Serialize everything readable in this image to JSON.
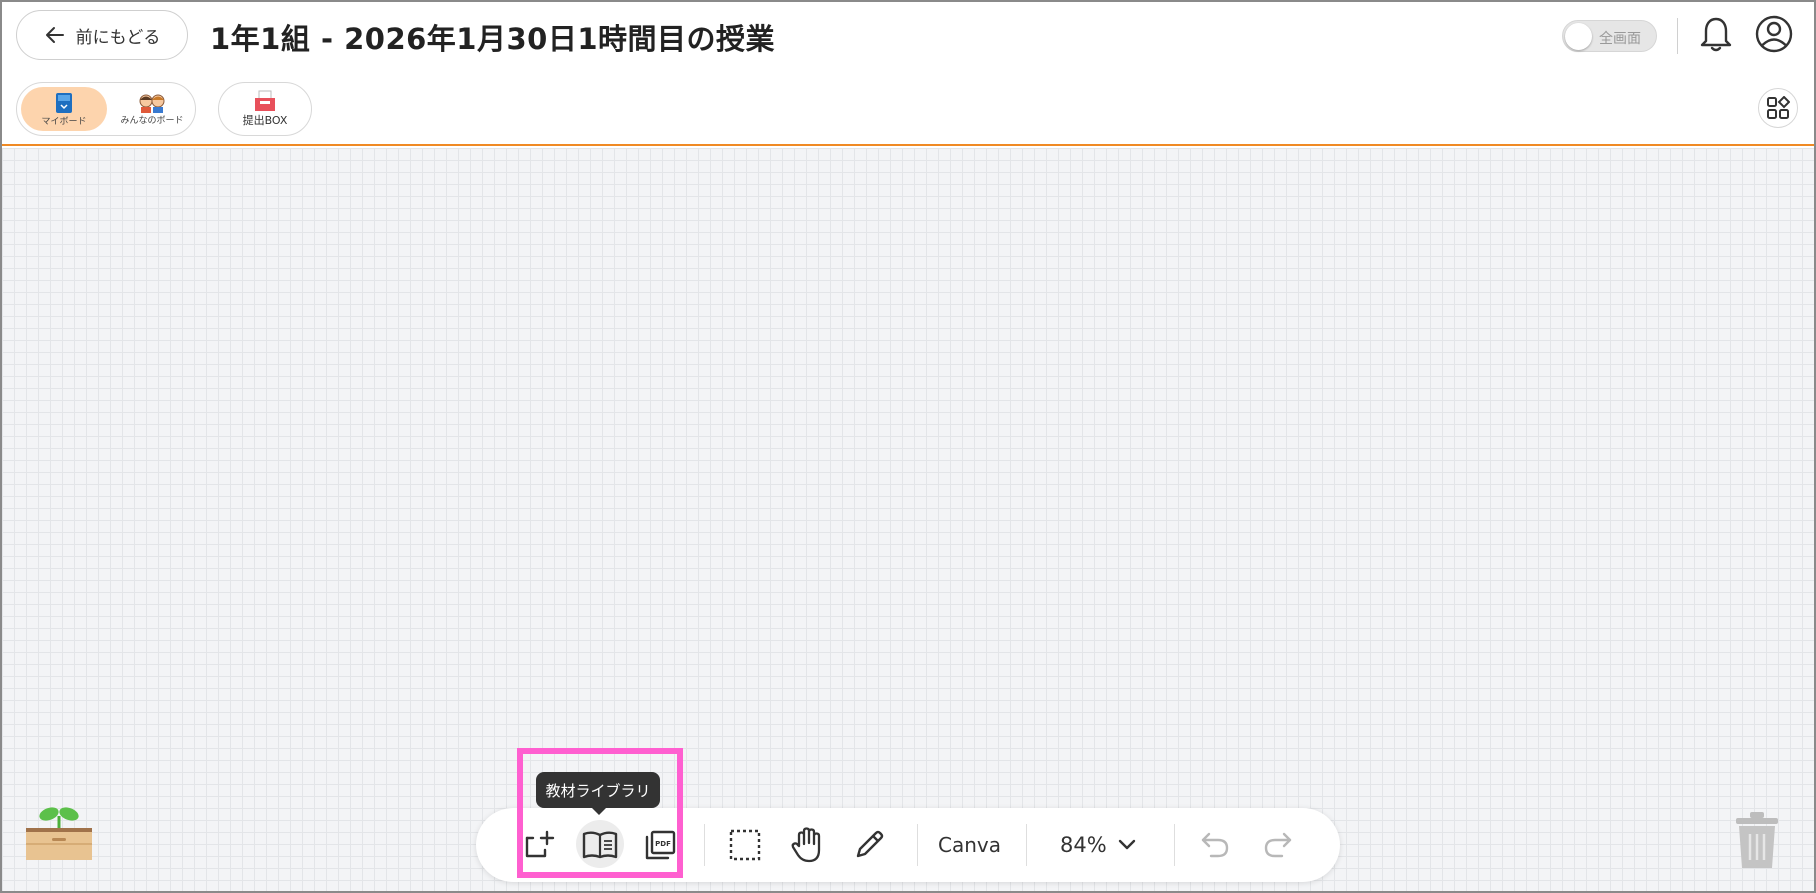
{
  "header": {
    "back_label": "前にもどる",
    "title": "1年1組 - 2026年1月30日1時間目の授業",
    "fullscreen_label": "全画面"
  },
  "boards": {
    "my_board_label": "マイボード",
    "everyone_board_label": "みんなのボード",
    "submit_box_label": "提出BOX"
  },
  "toolbar": {
    "tooltip": "教材ライブラリ",
    "canva_label": "Canva",
    "zoom_label": "84%"
  },
  "icons": {
    "back": "arrow-left-icon",
    "bell": "bell-icon",
    "user": "user-circle-icon",
    "apps": "apps-grid-icon",
    "add_card": "add-card-icon",
    "library": "open-book-icon",
    "pdf": "pdf-icon",
    "select": "marquee-select-icon",
    "hand": "hand-icon",
    "pen": "pencil-icon",
    "undo": "undo-icon",
    "redo": "redo-icon",
    "trash": "trash-icon",
    "seedling": "seedling-box-icon"
  },
  "colors": {
    "accent_orange": "#f08a24",
    "active_tab_bg": "#fdd4ad",
    "highlight": "#ff5fd0",
    "tooltip_bg": "#333333"
  }
}
